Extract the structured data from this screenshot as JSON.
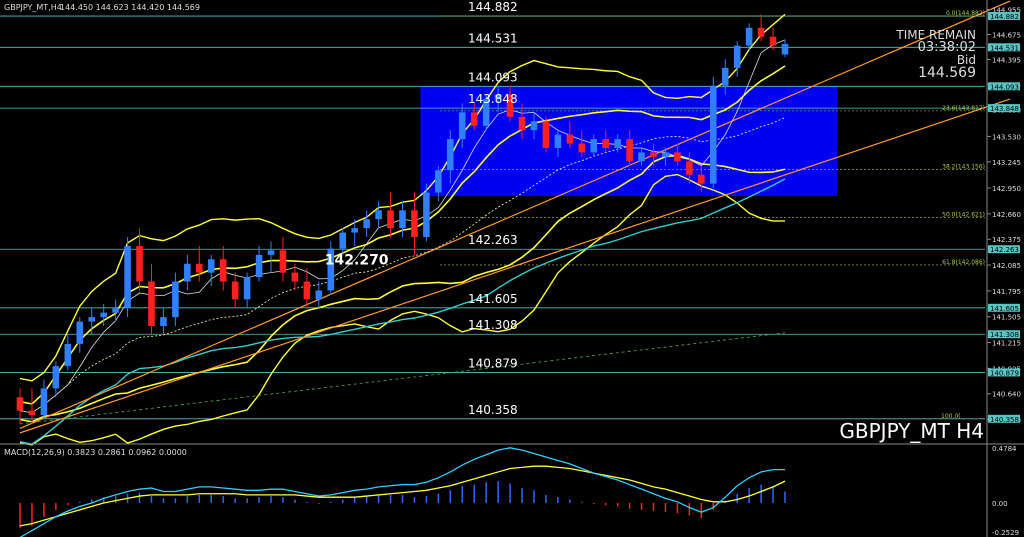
{
  "header": {
    "symbol_info": "GBPJPY_MT,H4",
    "ohlc": "144.450 144.623 144.420 144.569"
  },
  "overlay": {
    "time_remain_label": "TIME REMAIN",
    "time_remain_value": "03:38:02",
    "bid_label": "Bid",
    "bid_value": "144.569"
  },
  "watermark": "GBPJPY_MT H4",
  "colors": {
    "bull": "#2f7fff",
    "bear": "#ff2020",
    "bollinger": "#ffff33",
    "trend": "#ff9a2a",
    "ma_cyan": "#33cccc",
    "rect": "#0000ff",
    "level": "#59c4c4",
    "fib": "#aacc44",
    "macd_hist": "#2f66ff",
    "macd_signal": "#ffff33",
    "macd_main": "#33ccff"
  },
  "chart_data": {
    "type": "candlestick",
    "ylim": [
      140.12,
      144.95
    ],
    "y_ticks": [
      "144.955",
      "144.675",
      "144.395",
      "144.115",
      "143.830",
      "143.530",
      "143.245",
      "142.950",
      "142.660",
      "142.375",
      "142.085",
      "141.795",
      "141.505",
      "141.215",
      "140.925",
      "140.640",
      "140.350"
    ],
    "horizontal_levels": [
      {
        "label": "144.882",
        "value": 144.882
      },
      {
        "label": "144.531",
        "value": 144.531
      },
      {
        "label": "144.093",
        "value": 144.093
      },
      {
        "label": "143.848",
        "value": 143.848
      },
      {
        "label": "142.263",
        "value": 142.263
      },
      {
        "label": "141.605",
        "value": 141.605
      },
      {
        "label": "141.308",
        "value": 141.308
      },
      {
        "label": "140.879",
        "value": 140.879
      },
      {
        "label": "140.358",
        "value": 140.358
      }
    ],
    "axis_level_labels": [
      "144.882",
      "144.531",
      "144.093",
      "143.848",
      "142.263",
      "141.605",
      "141.308",
      "140.879",
      "140.358"
    ],
    "fib_levels": [
      {
        "label": "0.0(144.882)",
        "value": 144.882
      },
      {
        "label": "23.6(143.817)",
        "value": 143.817
      },
      {
        "label": "38.2(143.156)",
        "value": 143.156
      },
      {
        "label": "50.0(142.621)",
        "value": 142.621
      },
      {
        "label": "61.8(142.086)",
        "value": 142.086
      }
    ],
    "fib_bottom_label": "100.0(",
    "annotation": {
      "label": "142.270",
      "value": 142.27,
      "bar": 26
    },
    "box": {
      "from_bar": 34,
      "to_bar": 63,
      "top": 144.09,
      "bottom": 142.86
    },
    "candles": [
      [
        140.6,
        140.7,
        140.3,
        140.45
      ],
      [
        140.45,
        140.7,
        140.3,
        140.4
      ],
      [
        140.4,
        140.8,
        140.35,
        140.7
      ],
      [
        140.7,
        141.0,
        140.6,
        140.95
      ],
      [
        140.95,
        141.3,
        140.9,
        141.2
      ],
      [
        141.2,
        141.5,
        141.1,
        141.45
      ],
      [
        141.45,
        141.6,
        141.3,
        141.5
      ],
      [
        141.5,
        141.65,
        141.4,
        141.55
      ],
      [
        141.55,
        141.7,
        141.45,
        141.6
      ],
      [
        141.6,
        142.4,
        141.5,
        142.3
      ],
      [
        142.3,
        142.5,
        141.8,
        141.9
      ],
      [
        141.9,
        142.1,
        141.3,
        141.4
      ],
      [
        141.4,
        141.6,
        141.3,
        141.5
      ],
      [
        141.5,
        142.0,
        141.4,
        141.9
      ],
      [
        141.9,
        142.2,
        141.8,
        142.1
      ],
      [
        142.1,
        142.3,
        141.9,
        142.0
      ],
      [
        142.0,
        142.2,
        141.85,
        142.15
      ],
      [
        142.15,
        142.3,
        141.8,
        141.9
      ],
      [
        141.9,
        142.0,
        141.6,
        141.7
      ],
      [
        141.7,
        142.0,
        141.6,
        141.95
      ],
      [
        141.95,
        142.3,
        141.9,
        142.2
      ],
      [
        142.2,
        142.35,
        142.0,
        142.25
      ],
      [
        142.25,
        142.4,
        141.9,
        142.0
      ],
      [
        142.0,
        142.1,
        141.8,
        141.9
      ],
      [
        141.9,
        142.05,
        141.6,
        141.7
      ],
      [
        141.7,
        141.9,
        141.6,
        141.8
      ],
      [
        141.8,
        142.35,
        141.75,
        142.27
      ],
      [
        142.27,
        142.5,
        142.2,
        142.45
      ],
      [
        142.45,
        142.6,
        142.3,
        142.5
      ],
      [
        142.5,
        142.7,
        142.4,
        142.6
      ],
      [
        142.6,
        142.8,
        142.5,
        142.7
      ],
      [
        142.7,
        142.9,
        142.4,
        142.5
      ],
      [
        142.5,
        142.8,
        142.4,
        142.7
      ],
      [
        142.7,
        142.9,
        142.2,
        142.4
      ],
      [
        142.4,
        143.0,
        142.35,
        142.9
      ],
      [
        142.9,
        143.2,
        142.8,
        143.15
      ],
      [
        143.15,
        143.6,
        143.0,
        143.5
      ],
      [
        143.5,
        143.9,
        143.4,
        143.8
      ],
      [
        143.8,
        143.9,
        143.6,
        143.65
      ],
      [
        143.65,
        144.0,
        143.6,
        143.95
      ],
      [
        143.95,
        144.1,
        143.8,
        144.0
      ],
      [
        144.0,
        144.1,
        143.7,
        143.75
      ],
      [
        143.75,
        143.9,
        143.5,
        143.6
      ],
      [
        143.6,
        143.8,
        143.5,
        143.7
      ],
      [
        143.7,
        143.75,
        143.35,
        143.4
      ],
      [
        143.4,
        143.6,
        143.3,
        143.55
      ],
      [
        143.55,
        143.7,
        143.4,
        143.45
      ],
      [
        143.45,
        143.6,
        143.3,
        143.35
      ],
      [
        143.35,
        143.55,
        143.3,
        143.5
      ],
      [
        143.5,
        143.6,
        143.35,
        143.4
      ],
      [
        143.4,
        143.55,
        143.35,
        143.5
      ],
      [
        143.5,
        143.6,
        143.2,
        143.25
      ],
      [
        143.25,
        143.4,
        143.2,
        143.35
      ],
      [
        143.35,
        143.45,
        143.2,
        143.3
      ],
      [
        143.3,
        143.4,
        143.2,
        143.35
      ],
      [
        143.35,
        143.45,
        143.2,
        143.25
      ],
      [
        143.25,
        143.35,
        143.0,
        143.1
      ],
      [
        143.1,
        143.2,
        142.9,
        143.0
      ],
      [
        143.0,
        144.2,
        142.95,
        144.1
      ],
      [
        144.1,
        144.4,
        144.0,
        144.3
      ],
      [
        144.3,
        144.6,
        144.2,
        144.55
      ],
      [
        144.55,
        144.8,
        144.5,
        144.75
      ],
      [
        144.75,
        144.9,
        144.6,
        144.65
      ],
      [
        144.65,
        144.75,
        144.5,
        144.55
      ],
      [
        144.45,
        144.62,
        144.42,
        144.569
      ]
    ]
  },
  "macd": {
    "label": "MACD(12,26,9) 0.3823 0.2861 0.0962 0.0000",
    "ylim": [
      -0.2529,
      0.4784
    ],
    "y_ticks": [
      "0.4784",
      "0.00",
      "-0.2529"
    ],
    "hist": [
      -0.22,
      -0.2,
      -0.12,
      -0.06,
      -0.02,
      0.01,
      0.03,
      0.05,
      0.06,
      0.08,
      0.09,
      0.06,
      0.04,
      0.04,
      0.06,
      0.07,
      0.07,
      0.06,
      0.04,
      0.04,
      0.05,
      0.06,
      0.05,
      0.03,
      0.01,
      -0.01,
      0.01,
      0.03,
      0.05,
      0.06,
      0.07,
      0.07,
      0.07,
      0.05,
      0.06,
      0.08,
      0.11,
      0.15,
      0.16,
      0.18,
      0.19,
      0.17,
      0.13,
      0.11,
      0.07,
      0.05,
      0.03,
      0.01,
      -0.01,
      -0.02,
      -0.03,
      -0.05,
      -0.06,
      -0.07,
      -0.08,
      -0.09,
      -0.11,
      -0.13,
      -0.06,
      0.02,
      0.08,
      0.13,
      0.16,
      0.14,
      0.1
    ],
    "signal": [
      -0.2,
      -0.18,
      -0.15,
      -0.12,
      -0.09,
      -0.06,
      -0.03,
      0.0,
      0.02,
      0.04,
      0.06,
      0.07,
      0.07,
      0.07,
      0.07,
      0.08,
      0.08,
      0.08,
      0.08,
      0.07,
      0.07,
      0.07,
      0.07,
      0.07,
      0.06,
      0.05,
      0.05,
      0.05,
      0.05,
      0.06,
      0.07,
      0.08,
      0.09,
      0.1,
      0.11,
      0.13,
      0.15,
      0.18,
      0.21,
      0.24,
      0.27,
      0.3,
      0.31,
      0.32,
      0.32,
      0.31,
      0.3,
      0.28,
      0.26,
      0.24,
      0.22,
      0.2,
      0.17,
      0.14,
      0.12,
      0.09,
      0.06,
      0.03,
      0.01,
      0.01,
      0.03,
      0.06,
      0.1,
      0.14,
      0.19
    ],
    "main": [
      -0.3,
      -0.24,
      -0.18,
      -0.12,
      -0.07,
      -0.03,
      0.0,
      0.04,
      0.07,
      0.1,
      0.12,
      0.13,
      0.1,
      0.1,
      0.12,
      0.14,
      0.14,
      0.13,
      0.12,
      0.11,
      0.11,
      0.12,
      0.12,
      0.1,
      0.08,
      0.06,
      0.07,
      0.09,
      0.11,
      0.12,
      0.14,
      0.15,
      0.16,
      0.16,
      0.18,
      0.22,
      0.27,
      0.33,
      0.38,
      0.42,
      0.46,
      0.48,
      0.46,
      0.43,
      0.4,
      0.37,
      0.34,
      0.3,
      0.26,
      0.23,
      0.2,
      0.16,
      0.12,
      0.08,
      0.04,
      0.01,
      -0.04,
      -0.08,
      -0.04,
      0.05,
      0.15,
      0.22,
      0.27,
      0.29,
      0.29
    ]
  }
}
